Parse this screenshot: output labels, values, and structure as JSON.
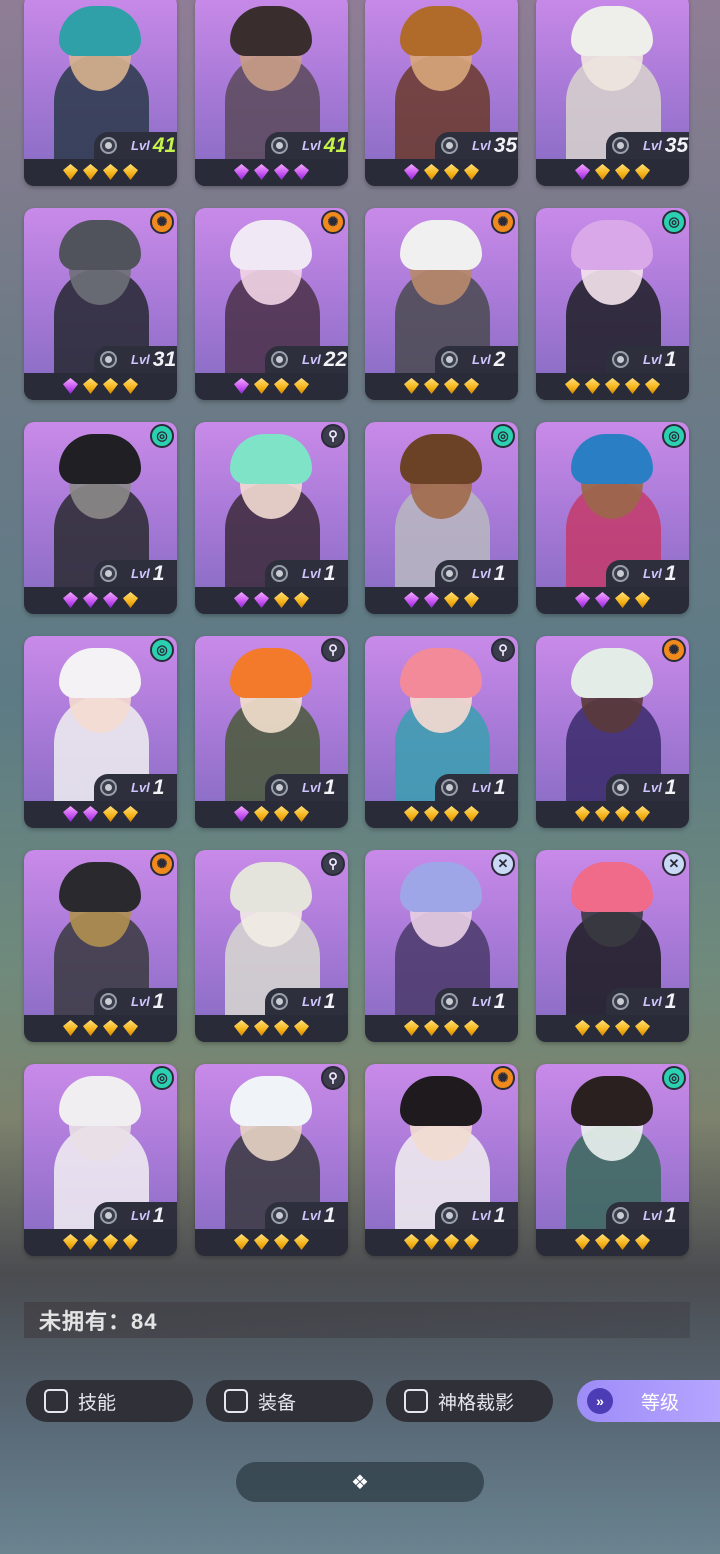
{
  "grid": {
    "cards": [
      {
        "lvl": "41",
        "gold": true,
        "gems": [
          "gold",
          "gold",
          "gold",
          "gold"
        ],
        "badge": "",
        "hair": "#2f9fa8",
        "skin": "#d7b48e",
        "cloth": "#2a3a4a"
      },
      {
        "lvl": "41",
        "gold": true,
        "gems": [
          "purple",
          "purple",
          "purple",
          "purple"
        ],
        "badge": "",
        "hair": "#3a2d2e",
        "skin": "#c89d85",
        "cloth": "#5b4a5a"
      },
      {
        "lvl": "35",
        "gold": false,
        "gems": [
          "purple",
          "gold",
          "gold",
          "gold"
        ],
        "badge": "",
        "hair": "#b06a2a",
        "skin": "#d9a77a",
        "cloth": "#6b3a2a"
      },
      {
        "lvl": "35",
        "gold": false,
        "gems": [
          "purple",
          "gold",
          "gold",
          "gold"
        ],
        "badge": "",
        "hair": "#eeeeea",
        "skin": "#f0e6df",
        "cloth": "#d8d3cc"
      },
      {
        "lvl": "31",
        "gold": false,
        "gems": [
          "purple",
          "gold",
          "gold",
          "gold"
        ],
        "badge": "orange",
        "hair": "#50525c",
        "skin": "#6e7078",
        "cloth": "#262830"
      },
      {
        "lvl": "22",
        "gold": false,
        "gems": [
          "purple",
          "gold",
          "gold",
          "gold"
        ],
        "badge": "orange",
        "hair": "#f1e8f5",
        "skin": "#f2d6e6",
        "cloth": "#4a3048"
      },
      {
        "lvl": "2",
        "gold": false,
        "gems": [
          "gold",
          "gold",
          "gold",
          "gold"
        ],
        "badge": "orange",
        "hair": "#f0f0f0",
        "skin": "#b88a6a",
        "cloth": "#4a4a50"
      },
      {
        "lvl": "1",
        "gold": false,
        "gems": [
          "gold",
          "gold",
          "gold",
          "gold",
          "gold"
        ],
        "badge": "teal",
        "hair": "#d8a8e8",
        "skin": "#f4e4ec",
        "cloth": "#1e1e26"
      },
      {
        "lvl": "1",
        "gold": false,
        "gems": [
          "purple",
          "purple",
          "purple",
          "gold"
        ],
        "badge": "teal",
        "hair": "#1f1f24",
        "skin": "#8c8a8a",
        "cloth": "#2a2a30"
      },
      {
        "lvl": "1",
        "gold": false,
        "gems": [
          "purple",
          "purple",
          "gold",
          "gold"
        ],
        "badge": "dark",
        "hair": "#7fe3c7",
        "skin": "#f3dcd0",
        "cloth": "#3c2a3a"
      },
      {
        "lvl": "1",
        "gold": false,
        "gems": [
          "purple",
          "purple",
          "gold",
          "gold"
        ],
        "badge": "teal",
        "hair": "#6b4226",
        "skin": "#a06a4a",
        "cloth": "#b8b8c0"
      },
      {
        "lvl": "1",
        "gold": false,
        "gems": [
          "purple",
          "purple",
          "gold",
          "gold"
        ],
        "badge": "teal",
        "hair": "#2a7fc4",
        "skin": "#9a6848",
        "cloth": "#c43a6a"
      },
      {
        "lvl": "1",
        "gold": false,
        "gems": [
          "purple",
          "purple",
          "gold",
          "gold"
        ],
        "badge": "teal",
        "hair": "#f4f2f4",
        "skin": "#f4dcd0",
        "cloth": "#f0f0f0"
      },
      {
        "lvl": "1",
        "gold": false,
        "gems": [
          "purple",
          "gold",
          "gold",
          "gold"
        ],
        "badge": "dark",
        "hair": "#f27a2a",
        "skin": "#f2e0cc",
        "cloth": "#4a5a3a"
      },
      {
        "lvl": "1",
        "gold": false,
        "gems": [
          "gold",
          "gold",
          "gold",
          "gold"
        ],
        "badge": "dark",
        "hair": "#f28a9a",
        "skin": "#f6dcd0",
        "cloth": "#3aa0b0"
      },
      {
        "lvl": "1",
        "gold": false,
        "gems": [
          "gold",
          "gold",
          "gold",
          "gold"
        ],
        "badge": "orange",
        "hair": "#e4ece8",
        "skin": "#5a3a3a",
        "cloth": "#3a2a6a"
      },
      {
        "lvl": "1",
        "gold": false,
        "gems": [
          "gold",
          "gold",
          "gold",
          "gold"
        ],
        "badge": "orange",
        "hair": "#2a2a2e",
        "skin": "#b09050",
        "cloth": "#3a3a40"
      },
      {
        "lvl": "1",
        "gold": false,
        "gems": [
          "gold",
          "gold",
          "gold",
          "gold"
        ],
        "badge": "dark",
        "hair": "#e4e4dc",
        "skin": "#f2ece6",
        "cloth": "#d8d8d0"
      },
      {
        "lvl": "1",
        "gold": false,
        "gems": [
          "gold",
          "gold",
          "gold",
          "gold"
        ],
        "badge": "cross",
        "hair": "#9fa6e8",
        "skin": "#e8d0e4",
        "cloth": "#4a3a6a"
      },
      {
        "lvl": "1",
        "gold": false,
        "gems": [
          "gold",
          "gold",
          "gold",
          "gold"
        ],
        "badge": "cross",
        "hair": "#f06a8a",
        "skin": "#3a3a42",
        "cloth": "#1a1a1e"
      },
      {
        "lvl": "1",
        "gold": false,
        "gems": [
          "gold",
          "gold",
          "gold",
          "gold"
        ],
        "badge": "teal",
        "hair": "#f0eef0",
        "skin": "#e8e0e4",
        "cloth": "#f2f0f2"
      },
      {
        "lvl": "1",
        "gold": false,
        "gems": [
          "gold",
          "gold",
          "gold",
          "gold"
        ],
        "badge": "dark",
        "hair": "#f0f4f8",
        "skin": "#e8d4c4",
        "cloth": "#3a3a40"
      },
      {
        "lvl": "1",
        "gold": false,
        "gems": [
          "gold",
          "gold",
          "gold",
          "gold"
        ],
        "badge": "orange",
        "hair": "#1e1a1e",
        "skin": "#f2dcd0",
        "cloth": "#f2f0f0"
      },
      {
        "lvl": "1",
        "gold": false,
        "gems": [
          "gold",
          "gold",
          "gold",
          "gold"
        ],
        "badge": "teal",
        "hair": "#2a2020",
        "skin": "#eaf2ee",
        "cloth": "#3a6a5a"
      }
    ]
  },
  "labels": {
    "lvl": "Lvl"
  },
  "unowned": {
    "text": "未拥有：84"
  },
  "filters": {
    "skill": "技能",
    "equipment": "装备",
    "divine": "神格裁影"
  },
  "sort": {
    "label": "等级",
    "icon_glyph": "»"
  },
  "bottom_handle": {
    "glyph": "❖"
  },
  "badge_glyphs": {
    "orange": "✺",
    "teal": "◎",
    "dark": "⚲",
    "cross": "✕"
  }
}
